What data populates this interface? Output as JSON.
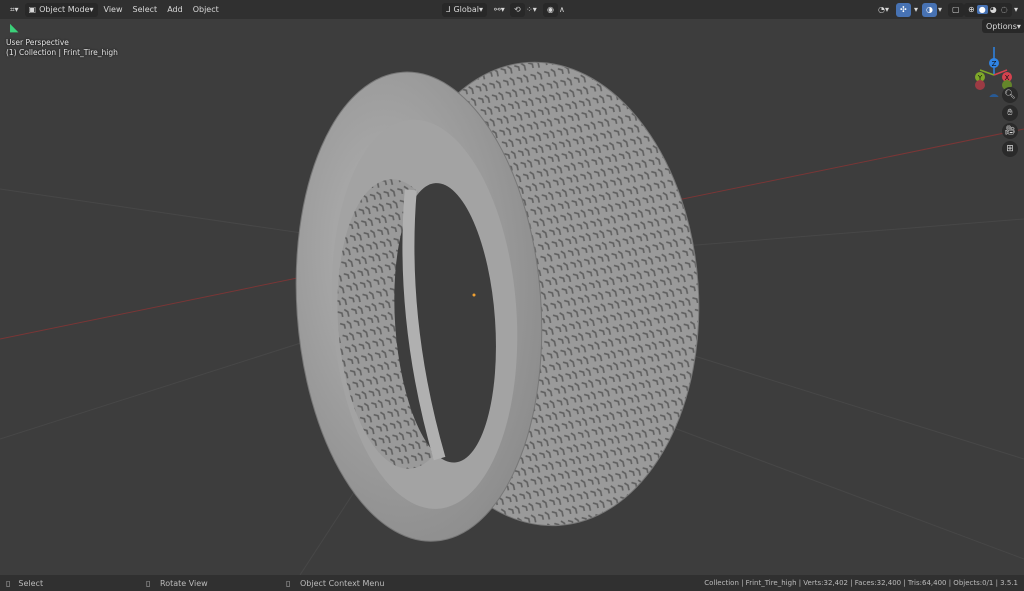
{
  "header": {
    "editor_icon": "editor-type-icon",
    "mode": "Object Mode",
    "menus": [
      "View",
      "Select",
      "Add",
      "Object"
    ],
    "transform_orientation": "Global",
    "options": "Options"
  },
  "viewport": {
    "perspective": "User Perspective",
    "collection_info": "(1) Collection | Frint_Tire_high",
    "gizmo_axes": [
      "X",
      "Y",
      "Z"
    ],
    "colors": {
      "x": "#d6424f",
      "y": "#7ea829",
      "z": "#2f84e5",
      "grid_x": "#8a3b3b",
      "bg": "#3d3d3d"
    }
  },
  "statusbar": {
    "select": "Select",
    "rotate": "Rotate View",
    "context": "Object Context Menu",
    "stats": "Collection | Frint_Tire_high | Verts:32,402 | Faces:32,400 | Tris:64,400 | Objects:0/1 | 3.5.1"
  }
}
